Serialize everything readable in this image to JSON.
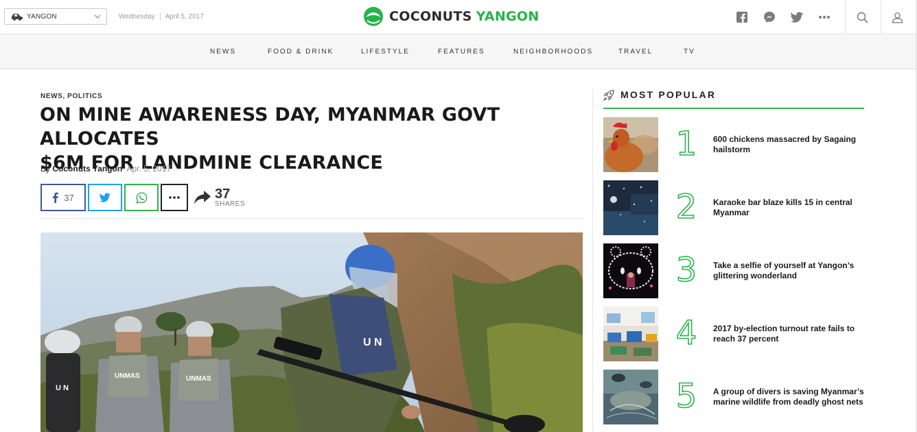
{
  "header": {
    "city": "YANGON",
    "date_day": "Wednesday",
    "date_full": "April 5, 2017",
    "logo_part1": "COCONUTS",
    "logo_part2": "YANGON"
  },
  "icons": {
    "social": [
      "facebook-icon",
      "messenger-icon",
      "twitter-icon",
      "more-icon"
    ],
    "utility": [
      "search-icon",
      "user-icon"
    ]
  },
  "nav": {
    "items": [
      "NEWS",
      "FOOD & DRINK",
      "LIFESTYLE",
      "FEATURES",
      "NEIGHBORHOODS",
      "TRAVEL",
      "TV"
    ]
  },
  "article": {
    "category1": "NEWS,",
    "category2": "POLITICS",
    "headline_line1": "ON MINE AWARENESS DAY, MYANMAR GOVT ALLOCATES",
    "headline_line2": "$6M FOR LANDMINE CLEARANCE",
    "by": "By",
    "author": "Coconuts Yangon",
    "published": "Apr. 5, 2017",
    "facebook_count": "37",
    "share_total": "37",
    "shares_label": "SHARES",
    "image_vest_text": "UNMAS",
    "image_helmet_text": "U N"
  },
  "sidebar": {
    "heading": "MOST POPULAR",
    "accent": "#2cb34a",
    "items": [
      {
        "rank": "1",
        "title": "600 chickens massacred by Sagaing hailstorm"
      },
      {
        "rank": "2",
        "title": "Karaoke bar blaze kills 15 in central Myanmar"
      },
      {
        "rank": "3",
        "title": "Take a selfie of yourself at Yangon’s glittering wonderland"
      },
      {
        "rank": "4",
        "title": "2017 by-election turnout rate fails to reach 37 percent"
      },
      {
        "rank": "5",
        "title": "A group of divers is saving Myanmar’s marine wildlife from deadly ghost nets"
      }
    ]
  }
}
